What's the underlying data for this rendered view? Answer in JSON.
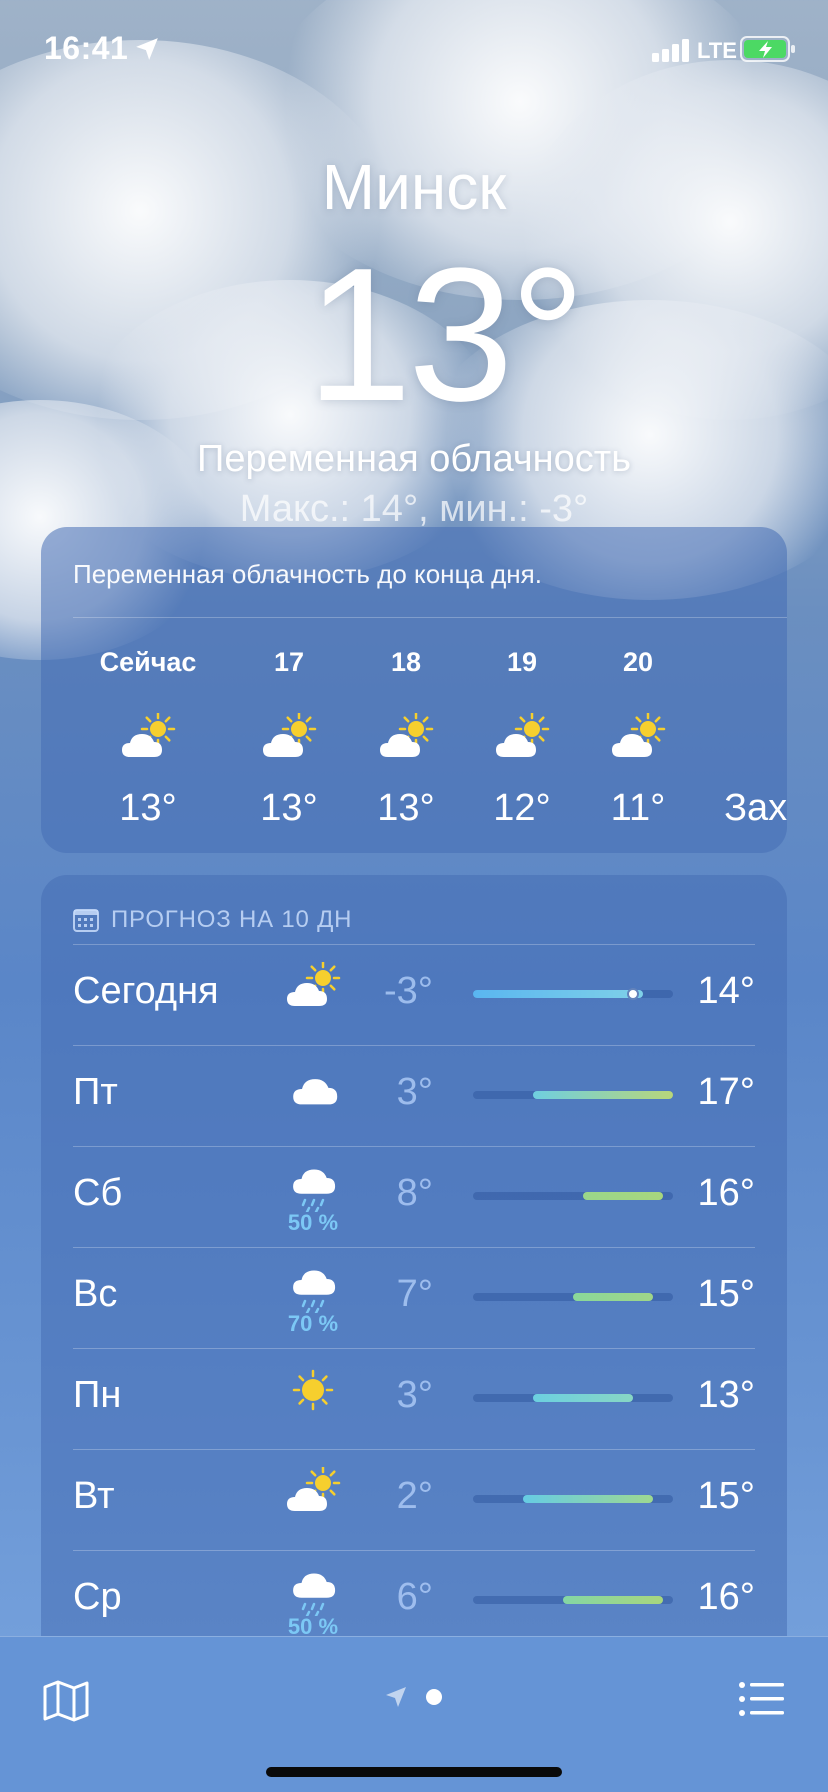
{
  "status": {
    "time": "16:41",
    "network": "LTE"
  },
  "location": {
    "city": "Минск",
    "temperature": "13°",
    "condition": "Переменная облачность",
    "hilo": "Макс.: 14°, мин.: -3°"
  },
  "hourly": {
    "summary": "Переменная облачность до конца дня.",
    "items": [
      {
        "label": "Сейчас",
        "icon": "partly-sunny-icon",
        "temp": "13°"
      },
      {
        "label": "17",
        "icon": "partly-sunny-icon",
        "temp": "13°"
      },
      {
        "label": "18",
        "icon": "partly-sunny-icon",
        "temp": "13°"
      },
      {
        "label": "19",
        "icon": "partly-sunny-icon",
        "temp": "12°"
      },
      {
        "label": "20",
        "icon": "partly-sunny-icon",
        "temp": "11°"
      },
      {
        "label": "",
        "icon": "",
        "temp": "Захо"
      }
    ]
  },
  "daily": {
    "title": "ПРОГНОЗ НА 10 ДН",
    "range": [
      -3,
      17
    ],
    "items": [
      {
        "day": "Сегодня",
        "icon": "partly-sunny-icon",
        "precip": "",
        "lo": "-3°",
        "hi": "14°",
        "lo_val": -3,
        "hi_val": 14,
        "current": 13,
        "colors": [
          "#5ab6f0",
          "#7fd0e8"
        ]
      },
      {
        "day": "Пт",
        "icon": "cloud-icon",
        "precip": "",
        "lo": "3°",
        "hi": "17°",
        "lo_val": 3,
        "hi_val": 17,
        "colors": [
          "#6fcfe0",
          "#b8d67a"
        ]
      },
      {
        "day": "Сб",
        "icon": "rain-icon",
        "precip": "50 %",
        "lo": "8°",
        "hi": "16°",
        "lo_val": 8,
        "hi_val": 16,
        "colors": [
          "#9ad68a",
          "#a8d67e"
        ]
      },
      {
        "day": "Вс",
        "icon": "rain-icon",
        "precip": "70 %",
        "lo": "7°",
        "hi": "15°",
        "lo_val": 7,
        "hi_val": 15,
        "colors": [
          "#8ad89a",
          "#a0d688"
        ]
      },
      {
        "day": "Пн",
        "icon": "sun-icon",
        "precip": "",
        "lo": "3°",
        "hi": "13°",
        "lo_val": 3,
        "hi_val": 13,
        "colors": [
          "#6cd0e0",
          "#88d6c4"
        ]
      },
      {
        "day": "Вт",
        "icon": "partly-sunny-icon",
        "precip": "",
        "lo": "2°",
        "hi": "15°",
        "lo_val": 2,
        "hi_val": 15,
        "colors": [
          "#66cce4",
          "#9ed890"
        ]
      },
      {
        "day": "Ср",
        "icon": "rain-icon",
        "precip": "50 %",
        "lo": "6°",
        "hi": "16°",
        "lo_val": 6,
        "hi_val": 16,
        "colors": [
          "#84d6a4",
          "#a8d67e"
        ]
      }
    ]
  },
  "colors": {
    "sun": "#f6cf2e",
    "precip": "#7cc8f5"
  }
}
